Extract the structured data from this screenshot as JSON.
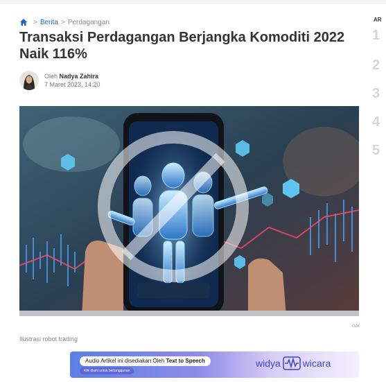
{
  "breadcrumb": {
    "items": [
      "Berita",
      "Perdagangan"
    ],
    "home_icon": "home-icon"
  },
  "article": {
    "title": "Transaksi Perdagangan Berjangka Komoditi 2022 Naik 116%",
    "author_prefix": "Oleh",
    "author_name": "Nadya Zahira",
    "date": "7 Maret 2023, 14:20",
    "image_credit": "OJK",
    "image_caption": "Ilustrasi robot trading"
  },
  "audio_banner": {
    "text_prefix": "Audio Artikel ini disediakan Oleh",
    "text_bold": "Text to Speech",
    "subtext": "Klik disini untuk berlangganan",
    "brand_left": "widya",
    "brand_right": "wicara"
  },
  "sidebar": {
    "heading": "AR",
    "numbers": [
      "1",
      "2",
      "3",
      "4",
      "5"
    ]
  },
  "colors": {
    "link": "#1b64c8",
    "title": "#333333",
    "banner_start": "#5b7fe6",
    "banner_end": "#f3f0ff"
  }
}
